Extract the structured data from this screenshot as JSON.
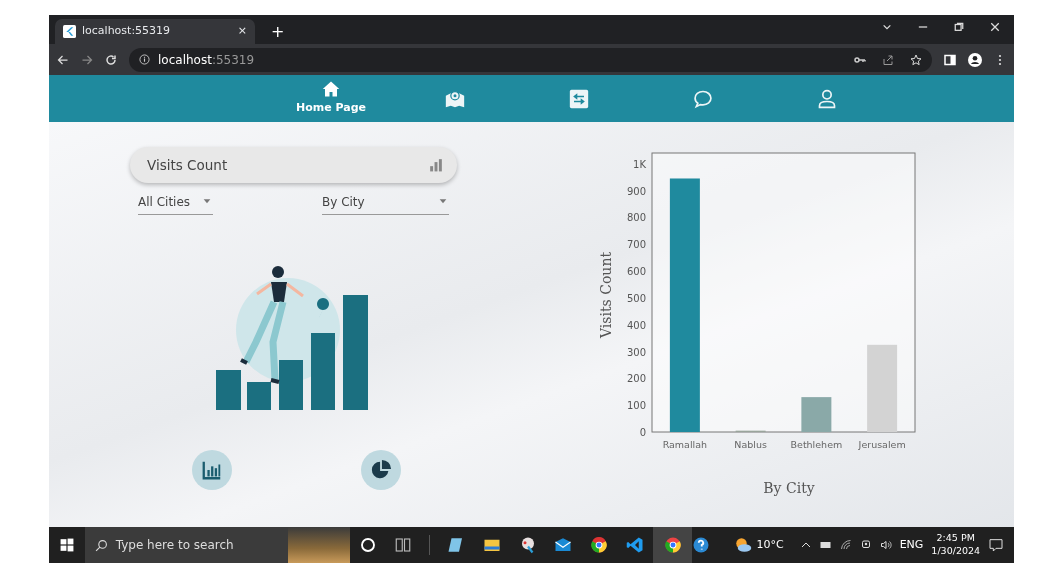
{
  "browser": {
    "tab_title": "localhost:55319",
    "tab_close": "×",
    "new_tab": "+",
    "address": "localhost",
    "address_port": ":55319"
  },
  "nav": [
    {
      "kind": "home",
      "label": "Home Page",
      "selected": true
    },
    {
      "kind": "map",
      "selected": false
    },
    {
      "kind": "exchange",
      "selected": false
    },
    {
      "kind": "chat",
      "selected": false
    },
    {
      "kind": "user",
      "selected": false
    }
  ],
  "metric_card": {
    "title": "Visits Count"
  },
  "filters": [
    {
      "value": "All Cities"
    },
    {
      "value": "By City"
    }
  ],
  "chart_buttons": [
    {
      "kind": "bar",
      "selected": false
    },
    {
      "kind": "pie",
      "selected": false
    }
  ],
  "chart": {
    "chart_data": {
      "type": "bar",
      "xlabel": "By City",
      "ylabel": "Visits Count",
      "categories": [
        "Ramallah",
        "Nablus",
        "Bethlehem",
        "Jerusalem"
      ],
      "series": [
        {
          "values": [
            945,
            5,
            130,
            325
          ]
        }
      ],
      "colors": [
        "#1f8a9e",
        "#9aa59c",
        "#8aa9a8",
        "#d3d3d3"
      ],
      "ylim": [
        0,
        1040
      ],
      "yticks": [
        0,
        100,
        200,
        300,
        400,
        500,
        600,
        700,
        800,
        900,
        {
          "value": 1000,
          "label": "1K"
        }
      ]
    }
  },
  "taskbar": {
    "search_placeholder": "Type here to search",
    "weather": "10°C",
    "language": "ENG",
    "time": "2:45 PM",
    "date": "1/30/2024"
  }
}
